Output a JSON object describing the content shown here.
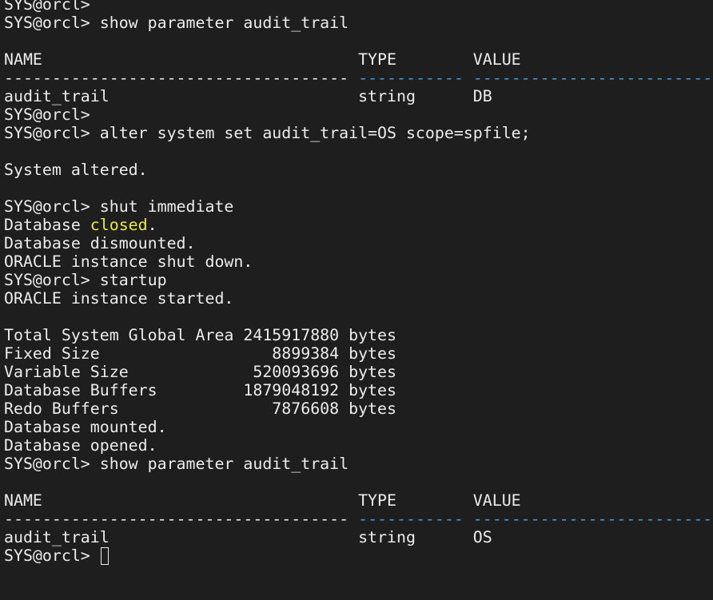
{
  "terminal": {
    "lines": [
      "SYS@orcl>",
      "SYS@orcl> show parameter audit_trail",
      "",
      "NAME                                 TYPE        VALUE",
      {
        "a": "------------------------------------ ",
        "b": "----------- ",
        "c": "------------------------------"
      },
      "audit_trail                          string      DB",
      "SYS@orcl>",
      "SYS@orcl> alter system set audit_trail=OS scope=spfile;",
      "",
      "System altered.",
      "",
      "SYS@orcl> shut immediate",
      {
        "before": "Database ",
        "highlight": "closed",
        "after": "."
      },
      "Database dismounted.",
      "ORACLE instance shut down.",
      "SYS@orcl> startup",
      "ORACLE instance started.",
      "",
      "Total System Global Area 2415917880 bytes",
      "Fixed Size                  8899384 bytes",
      "Variable Size             520093696 bytes",
      "Database Buffers         1879048192 bytes",
      "Redo Buffers                7876608 bytes",
      "Database mounted.",
      "Database opened.",
      "SYS@orcl> show parameter audit_trail",
      "",
      "NAME                                 TYPE        VALUE",
      {
        "a": "------------------------------------ ",
        "b": "----------- ",
        "c": "------------------------------"
      },
      "audit_trail                          string      OS",
      "SYS@orcl> "
    ]
  },
  "colors": {
    "background": "#1e1e1e",
    "text": "#ececec",
    "dash_accent": "#3f9ad6",
    "highlight": "#e8e84a"
  }
}
